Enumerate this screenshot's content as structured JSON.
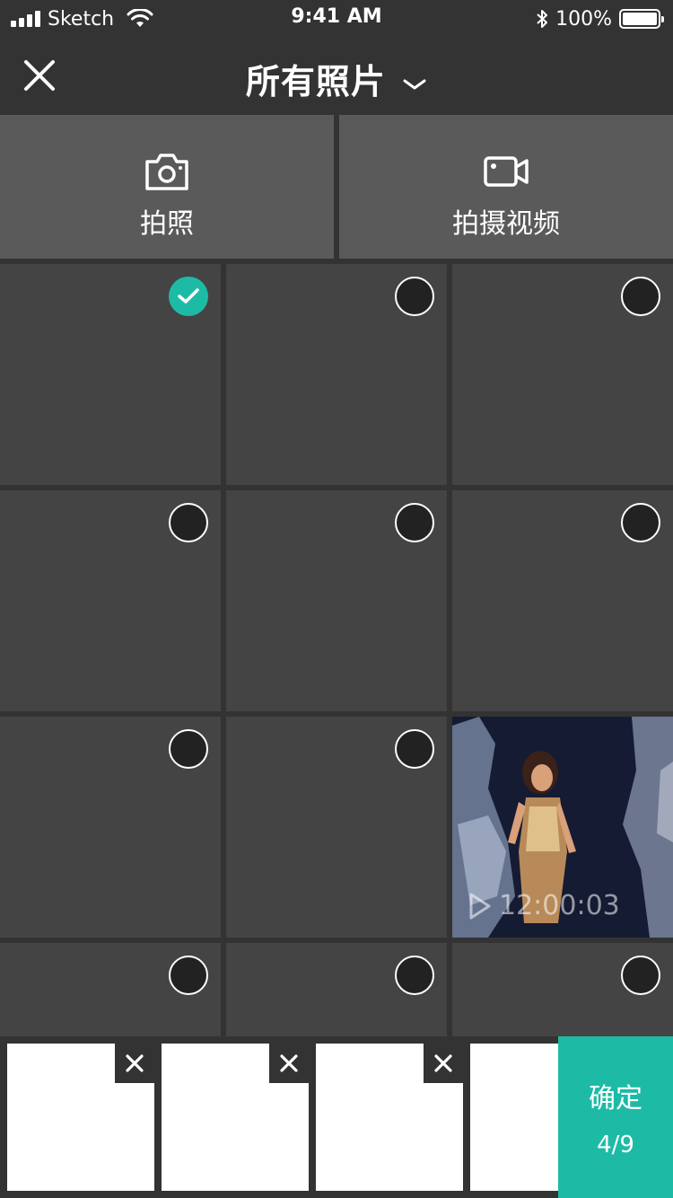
{
  "status_bar": {
    "carrier": "Sketch",
    "time": "9:41 AM",
    "battery": "100%"
  },
  "nav": {
    "title": "所有照片",
    "icons": [
      "close-icon",
      "chevron-down-icon"
    ]
  },
  "capture": {
    "photo_label": "拍照",
    "video_label": "拍摄视频",
    "icons": [
      "camera-icon",
      "video-camera-icon"
    ]
  },
  "grid": {
    "items": [
      {
        "selected": true
      },
      {
        "selected": false
      },
      {
        "selected": false
      },
      {
        "selected": false
      },
      {
        "selected": false
      },
      {
        "selected": false
      },
      {
        "selected": false
      },
      {
        "selected": false
      },
      {
        "type": "video",
        "duration": "12:00:03"
      },
      {
        "selected": false
      },
      {
        "selected": false
      },
      {
        "selected": false
      }
    ]
  },
  "tray": {
    "thumbnails": 4,
    "confirm_label": "确定",
    "count": "4/9"
  },
  "colors": {
    "accent": "#1dbba5",
    "background": "#333333",
    "cell": "#444444",
    "capture_button": "#5a5a5a"
  }
}
